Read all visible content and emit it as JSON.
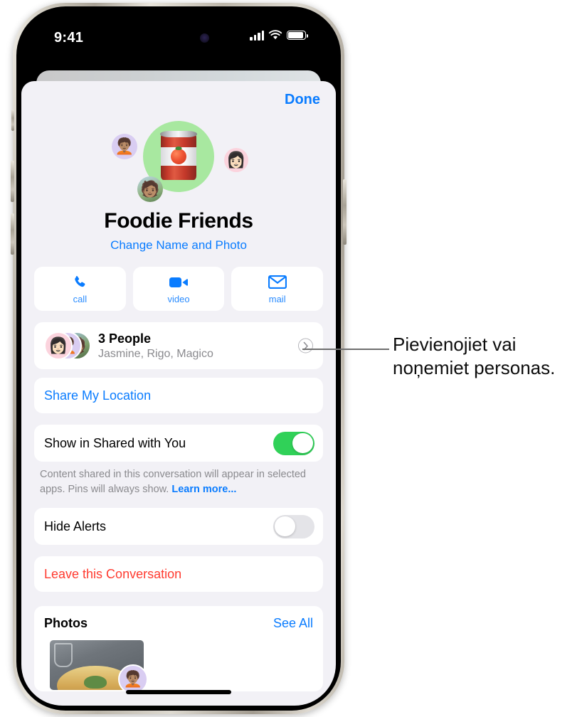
{
  "status_bar": {
    "time": "9:41",
    "icons": [
      "cellular-signal-icon",
      "wifi-icon",
      "battery-icon"
    ]
  },
  "sheet": {
    "done_label": "Done"
  },
  "group": {
    "name": "Foodie Friends",
    "avatar_emoji": "canned-food-icon",
    "change_link": "Change Name and Photo"
  },
  "actions": [
    {
      "label": "call",
      "icon": "phone-icon"
    },
    {
      "label": "video",
      "icon": "video-camera-icon"
    },
    {
      "label": "mail",
      "icon": "envelope-icon"
    }
  ],
  "people": {
    "title": "3 People",
    "subtitle": "Jasmine, Rigo, Magico"
  },
  "share_location": {
    "label": "Share My Location"
  },
  "shared_with_you": {
    "label": "Show in Shared with You",
    "state": "on",
    "footnote_text": "Content shared in this conversation will appear in selected apps. Pins will always show. ",
    "footnote_link": "Learn more..."
  },
  "hide_alerts": {
    "label": "Hide Alerts",
    "state": "off"
  },
  "leave": {
    "label": "Leave this Conversation"
  },
  "photos": {
    "title": "Photos",
    "see_all_label": "See All"
  },
  "annotation": {
    "line1": "Pievienojiet vai",
    "line2": "noņemiet personas."
  },
  "colors": {
    "accent_blue": "#0a7cff",
    "destructive_red": "#ff3b30",
    "switch_on_green": "#30d158",
    "sheet_bg": "#f2f1f6",
    "avatar_green": "#a8e8a0"
  }
}
